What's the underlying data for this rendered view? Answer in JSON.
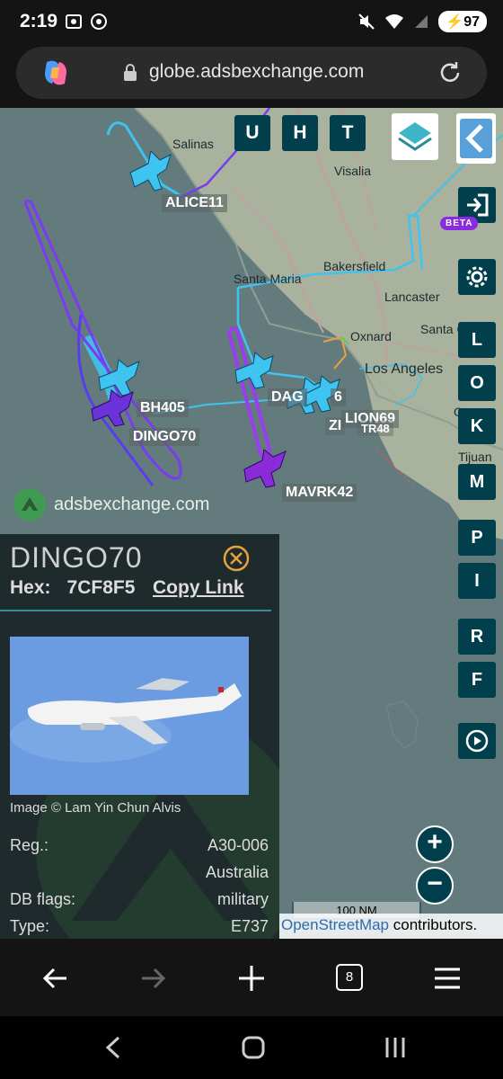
{
  "status_bar": {
    "time": "2:19",
    "battery": "97",
    "icons": [
      "screenshot-icon",
      "hotspot-icon",
      "mute-icon",
      "wifi-icon",
      "signal-icon",
      "battery-icon"
    ]
  },
  "browser": {
    "url": "globe.adsbexchange.com"
  },
  "map": {
    "place_labels": [
      "Salinas",
      "Visalia",
      "Bakersfield",
      "Santa Maria",
      "Lancaster",
      "Santa Clar",
      "Oxnard",
      "Los Angeles",
      "Ocea",
      "Tijuan"
    ],
    "aircraft_labels": [
      "ALICE11",
      "BH405",
      "DINGO70",
      "DAG",
      "6",
      "LION69",
      "ZI",
      "TR48",
      "MAVRK42"
    ],
    "top_buttons": [
      "U",
      "H",
      "T"
    ],
    "side_buttons": [
      "L",
      "O",
      "K",
      "M",
      "P",
      "I",
      "R",
      "F"
    ],
    "beta_badge": "BETA",
    "logo_text": "adsbexchange.com",
    "scale_label": "100 NM",
    "attribution_link": "OpenStreetMap",
    "attribution_text": " contributors."
  },
  "info_panel": {
    "callsign": "DINGO70",
    "hex_label": "Hex:",
    "hex_value": "7CF8F5",
    "copy_link": "Copy Link",
    "image_credit": "Image © Lam Yin Chun Alvis",
    "rows": [
      {
        "label": "Reg.:",
        "value": "A30-006"
      },
      {
        "label": "",
        "value": "Australia"
      },
      {
        "label": "DB flags:",
        "value": "military"
      },
      {
        "label": "Type:",
        "value": "E737"
      }
    ]
  },
  "browser_nav": {
    "tab_count": "8"
  },
  "colors": {
    "accent_teal": "#003f4b",
    "track_cyan": "#3fc3f0",
    "track_purple": "#7a3cf0",
    "beta_purple": "#8a2be2"
  }
}
